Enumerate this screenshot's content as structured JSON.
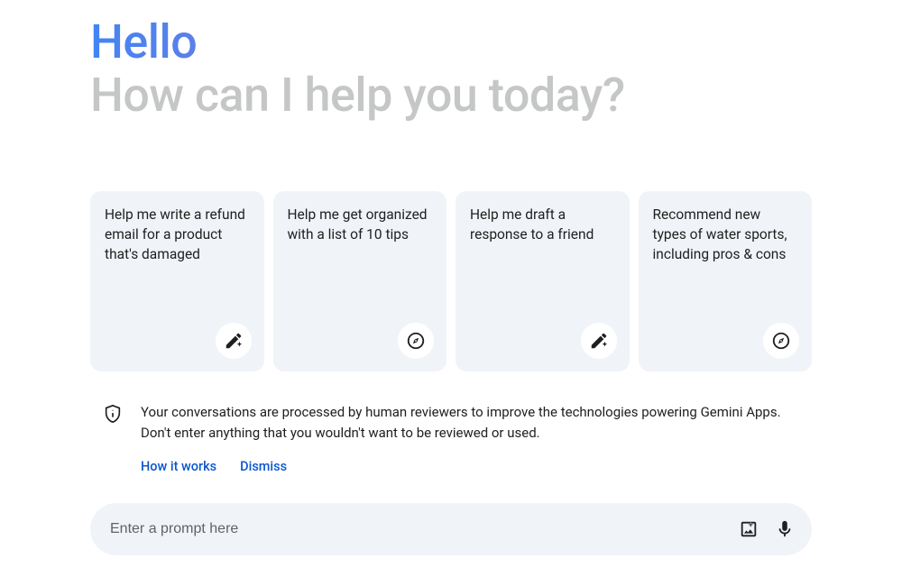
{
  "greeting": "Hello",
  "subheading": "How can I help you today?",
  "cards": [
    {
      "text": "Help me write a refund email for a product that's damaged",
      "icon": "pencil-spark-icon"
    },
    {
      "text": "Help me get organized with a list of 10 tips",
      "icon": "compass-icon"
    },
    {
      "text": "Help me draft a response to a friend",
      "icon": "pencil-spark-icon"
    },
    {
      "text": "Recommend new types of water sports, including pros & cons",
      "icon": "compass-icon"
    }
  ],
  "notice": {
    "text": "Your conversations are processed by human reviewers to improve the technologies powering Gemini Apps. Don't enter anything that you wouldn't want to be reviewed or used.",
    "how_it_works": "How it works",
    "dismiss": "Dismiss"
  },
  "prompt": {
    "placeholder": "Enter a prompt here"
  }
}
